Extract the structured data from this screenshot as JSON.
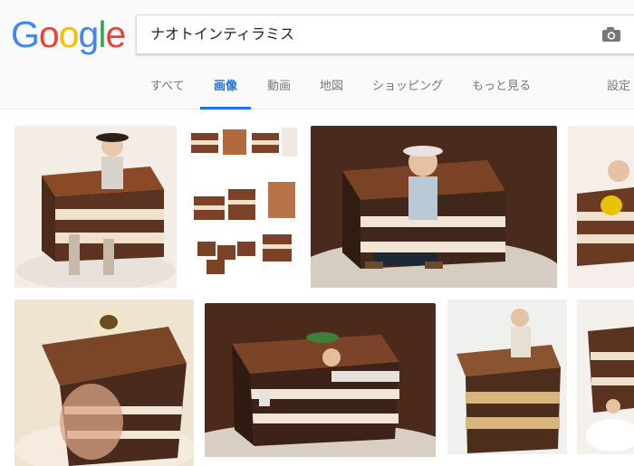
{
  "logo": {
    "letters": [
      "G",
      "o",
      "o",
      "g",
      "l",
      "e"
    ],
    "colors": [
      "#4285f4",
      "#ea4335",
      "#fbbc05",
      "#4285f4",
      "#34a853",
      "#ea4335"
    ]
  },
  "search": {
    "query": "ナオトインティラミス"
  },
  "tabs": [
    {
      "label": "すべて"
    },
    {
      "label": "画像"
    },
    {
      "label": "動画"
    },
    {
      "label": "地図"
    },
    {
      "label": "ショッピング"
    },
    {
      "label": "もっと見る"
    },
    {
      "label": "設定"
    }
  ],
  "active_tab": "画像",
  "results": [
    {
      "name": "result-1"
    },
    {
      "name": "result-2"
    },
    {
      "name": "result-3"
    },
    {
      "name": "result-4"
    },
    {
      "name": "result-5"
    },
    {
      "name": "result-6"
    },
    {
      "name": "result-7"
    },
    {
      "name": "result-8"
    }
  ],
  "colors": {
    "accent": "#1a73e8",
    "cocoa": "#6b3a20",
    "cake_dark": "#3b2116",
    "cream": "#f3ead8"
  }
}
